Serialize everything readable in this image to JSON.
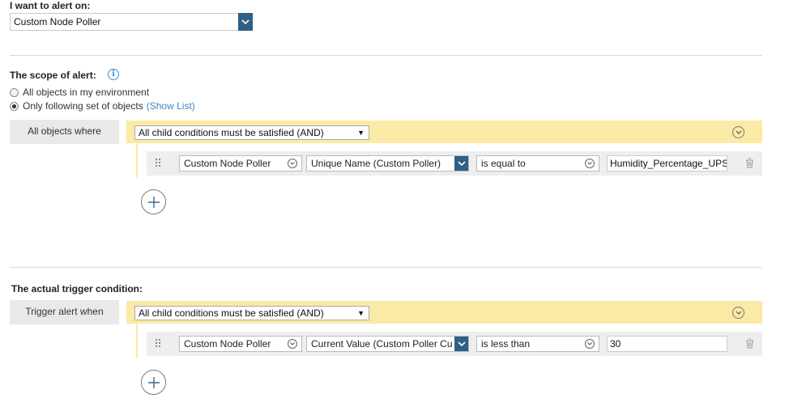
{
  "alert_on": {
    "label": "I want to alert on:",
    "selected": "Custom Node Poller"
  },
  "scope": {
    "label": "The scope of alert:",
    "options": [
      {
        "label": "All objects in my environment",
        "checked": false
      },
      {
        "label": "Only following set of objects",
        "checked": true
      }
    ],
    "show_list_link": "(Show List)",
    "side_label": "All objects where",
    "group_operator": "All child conditions must be satisfied (AND)",
    "condition": {
      "object": "Custom Node Poller",
      "field": "Unique Name (Custom Poller)",
      "operator": "is equal to",
      "value": "Humidity_Percentage_UPS"
    }
  },
  "trigger": {
    "label": "The actual trigger condition:",
    "side_label": "Trigger alert when",
    "group_operator": "All child conditions must be satisfied (AND)",
    "condition": {
      "object": "Custom Node Poller",
      "field": "Current Value (Custom Poller Cu",
      "operator": "is less than",
      "value": "30"
    }
  },
  "colors": {
    "accent_dark_blue": "#2f5f84",
    "condition_bar_yellow": "#faeaa6",
    "link_blue": "#3b87c8"
  },
  "icons": [
    "chevron-down-icon",
    "info-icon",
    "collapse-chevron-icon",
    "drag-grip-icon",
    "trash-icon",
    "plus-icon"
  ]
}
